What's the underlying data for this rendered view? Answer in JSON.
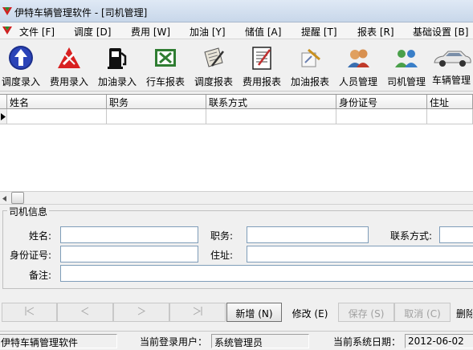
{
  "window": {
    "title": "伊特车辆管理软件 - [司机管理]"
  },
  "menu": [
    "文件 [F]",
    "调度 [D]",
    "费用 [W]",
    "加油 [Y]",
    "储值 [A]",
    "提醒 [T]",
    "报表 [R]",
    "基础设置 [B]"
  ],
  "toolbar": [
    {
      "label": "调度录入",
      "icon": "up-arrow-icon"
    },
    {
      "label": "费用录入",
      "icon": "tools-icon"
    },
    {
      "label": "加油录入",
      "icon": "fuel-pump-icon"
    },
    {
      "label": "行车报表",
      "icon": "excel-icon"
    },
    {
      "label": "调度报表",
      "icon": "scroll-pen-icon"
    },
    {
      "label": "费用报表",
      "icon": "notebook-icon"
    },
    {
      "label": "加油报表",
      "icon": "sketch-icon"
    },
    {
      "label": "人员管理",
      "icon": "people-icon"
    },
    {
      "label": "司机管理",
      "icon": "drivers-icon"
    },
    {
      "label": "车辆管理",
      "icon": "car-icon"
    }
  ],
  "grid": {
    "columns": [
      "姓名",
      "职务",
      "联系方式",
      "身份证号",
      "住址"
    ]
  },
  "form": {
    "group_title": "司机信息",
    "name_label": "姓名:",
    "position_label": "职务:",
    "contact_label": "联系方式:",
    "id_label": "身份证号:",
    "address_label": "住址:",
    "remark_label": "备注:"
  },
  "buttons": {
    "new": "新增 (N)",
    "edit": "修改 (E)",
    "save": "保存 (S)",
    "cancel": "取消 (C)",
    "delete": "删除"
  },
  "status": {
    "app": "伊特车辆管理软件",
    "user_label": "当前登录用户：",
    "user": "系统管理员",
    "date_label": "当前系统日期：",
    "date": "2012-06-02"
  }
}
